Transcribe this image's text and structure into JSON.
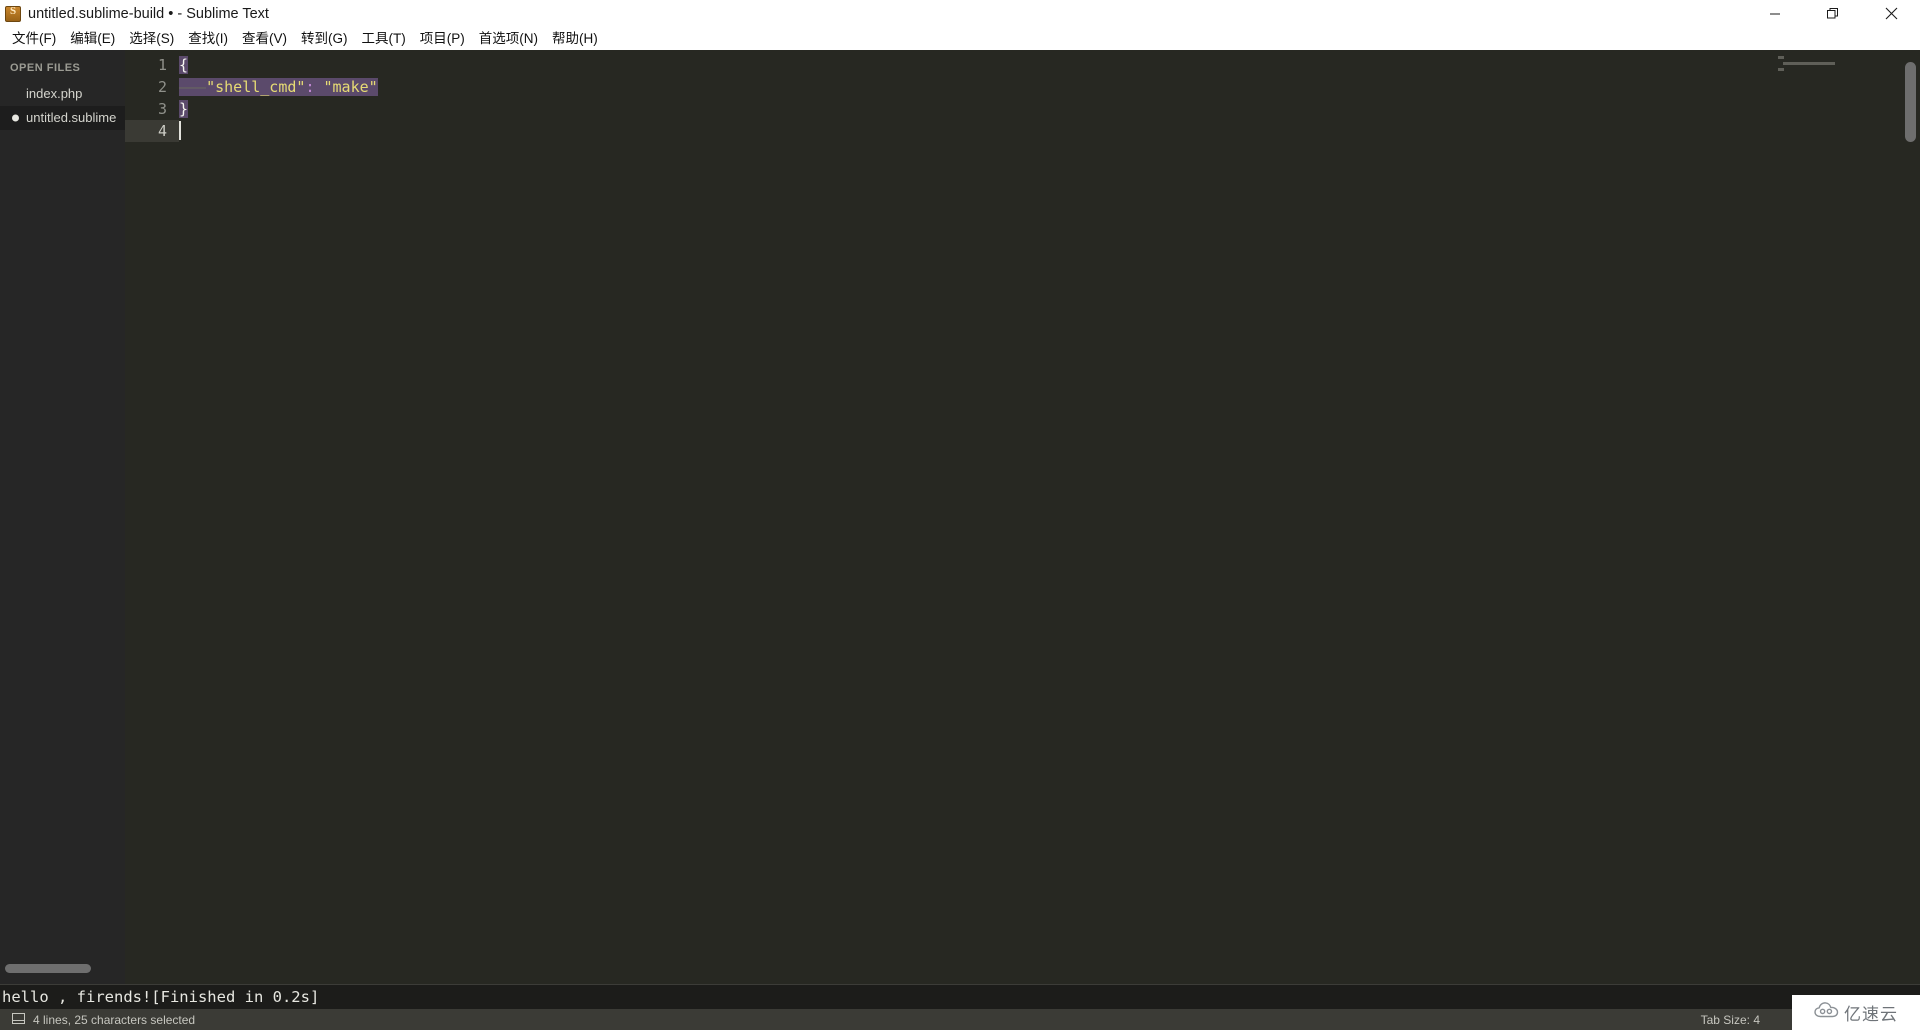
{
  "window": {
    "title": "untitled.sublime-build • - Sublime Text",
    "icon": "sublime-text-icon",
    "controls": {
      "minimize": "minimize-button",
      "restore": "restore-button",
      "close": "close-button"
    }
  },
  "menubar": {
    "items": [
      {
        "label": "文件(F)"
      },
      {
        "label": "编辑(E)"
      },
      {
        "label": "选择(S)"
      },
      {
        "label": "查找(I)"
      },
      {
        "label": "查看(V)"
      },
      {
        "label": "转到(G)"
      },
      {
        "label": "工具(T)"
      },
      {
        "label": "项目(P)"
      },
      {
        "label": "首选项(N)"
      },
      {
        "label": "帮助(H)"
      }
    ]
  },
  "sidebar": {
    "header": "OPEN FILES",
    "files": [
      {
        "name": "index.php",
        "modified": false,
        "active": false
      },
      {
        "name": "untitled.sublime",
        "modified": true,
        "active": true
      }
    ]
  },
  "editor": {
    "lines": [
      {
        "number": "1",
        "text": "{"
      },
      {
        "number": "2",
        "text": "\t\"shell_cmd\": \"make\""
      },
      {
        "number": "3",
        "text": "}"
      },
      {
        "number": "4",
        "text": ""
      }
    ],
    "tokens": {
      "open_brace": "{",
      "tab_guide": "———",
      "key": "\"shell_cmd\"",
      "colon": ":",
      "space": " ",
      "value": "\"make\"",
      "close_brace": "}"
    },
    "selection_color": "#5b4a6b",
    "background": "#272822"
  },
  "output": {
    "text": "hello , firends![Finished in 0.2s]"
  },
  "statusbar": {
    "icon": "layout-icon",
    "selection_info": "4 lines, 25 characters selected",
    "tab_size": "Tab Size: 4"
  },
  "watermark": {
    "logo": "cloud-logo-icon",
    "text": "亿速云"
  }
}
